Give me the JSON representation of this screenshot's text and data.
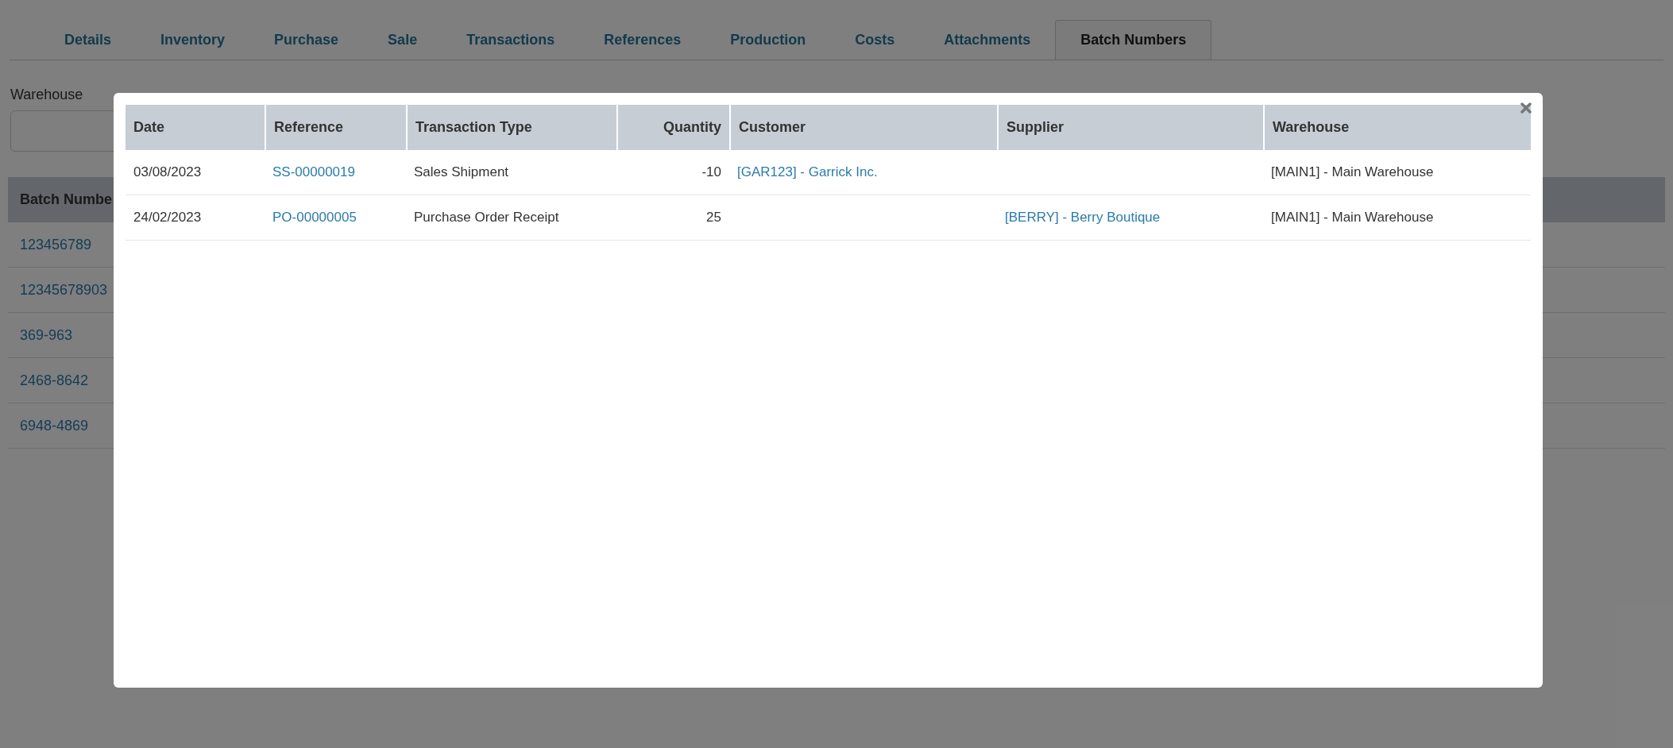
{
  "tabs": [
    {
      "label": "Details",
      "selected": false
    },
    {
      "label": "Inventory",
      "selected": false
    },
    {
      "label": "Purchase",
      "selected": false
    },
    {
      "label": "Sale",
      "selected": false
    },
    {
      "label": "Transactions",
      "selected": false
    },
    {
      "label": "References",
      "selected": false
    },
    {
      "label": "Production",
      "selected": false
    },
    {
      "label": "Costs",
      "selected": false
    },
    {
      "label": "Attachments",
      "selected": false
    },
    {
      "label": "Batch Numbers",
      "selected": true
    }
  ],
  "filters": [
    {
      "label": "Warehouse",
      "kind": "field"
    }
  ],
  "batch_table": {
    "columns": [
      "Batch Numbe"
    ],
    "rows": [
      "123456789",
      "12345678903",
      "369-963",
      "2468-8642",
      "6948-4869"
    ]
  },
  "modal": {
    "columns": [
      {
        "label": "Date",
        "kind": "text"
      },
      {
        "label": "Reference",
        "kind": "link"
      },
      {
        "label": "Transaction Type",
        "kind": "text"
      },
      {
        "label": "Quantity",
        "kind": "number"
      },
      {
        "label": "Customer",
        "kind": "link"
      },
      {
        "label": "Supplier",
        "kind": "link"
      },
      {
        "label": "Warehouse",
        "kind": "text"
      }
    ],
    "rows": [
      {
        "date": "03/08/2023",
        "reference": "SS-00000019",
        "transaction_type": "Sales Shipment",
        "quantity": "-10",
        "customer": "[GAR123] - Garrick Inc.",
        "warehouse": "[MAIN1] - Main Warehouse"
      },
      {
        "date": "24/02/2023",
        "reference": "PO-00000005",
        "transaction_type": "Purchase Order Receipt",
        "quantity": "25",
        "supplier": "[BERRY] - Berry Boutique",
        "warehouse": "[MAIN1] - Main Warehouse"
      }
    ]
  }
}
